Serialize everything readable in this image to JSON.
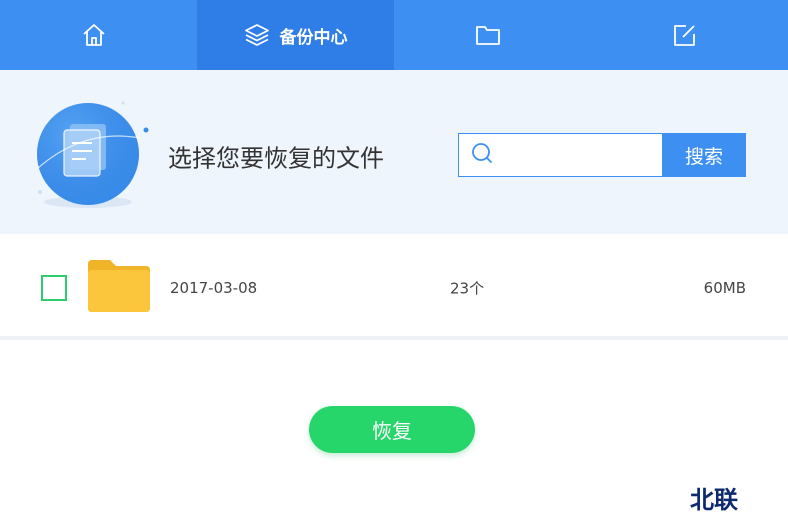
{
  "nav": {
    "tabs": [
      {
        "label": "",
        "icon": "home-icon"
      },
      {
        "label": "备份中心",
        "icon": "layers-icon",
        "active": true
      },
      {
        "label": "",
        "icon": "folder-icon"
      },
      {
        "label": "",
        "icon": "edit-icon"
      }
    ]
  },
  "header": {
    "title": "选择您要恢复的文件",
    "search_placeholder": "",
    "search_button": "搜索"
  },
  "files": [
    {
      "date": "2017-03-08",
      "count": "23个",
      "size": "60MB",
      "checked": false
    }
  ],
  "actions": {
    "restore_label": "恢复"
  },
  "watermark": "北联",
  "colors": {
    "nav_bg": "#3d8ff2",
    "nav_active": "#2f7de6",
    "header_bg": "#eef5fd",
    "accent_green": "#27d66b",
    "folder_yellow": "#f7c23c"
  }
}
